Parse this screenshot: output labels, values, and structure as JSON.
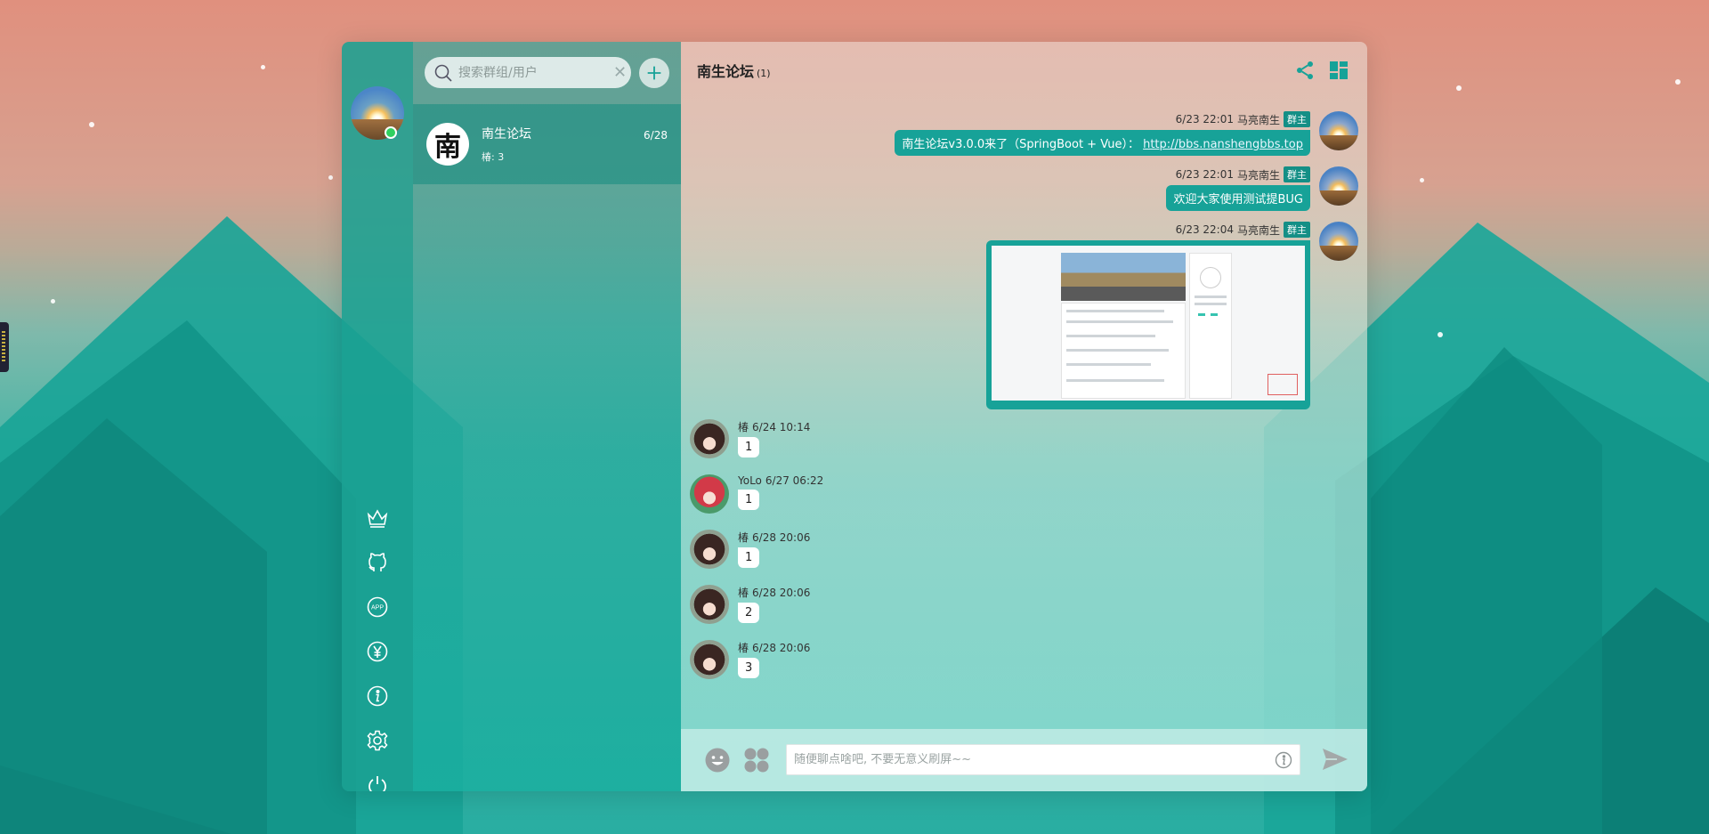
{
  "sidebar": {
    "user": {
      "online": true
    },
    "icons": [
      "crown-icon",
      "github-icon",
      "app-icon",
      "yen-icon",
      "info-icon",
      "settings-icon",
      "power-icon"
    ],
    "app_icon_text": "APP"
  },
  "search": {
    "placeholder": "搜索群组/用户"
  },
  "conversations": [
    {
      "name": "南生论坛",
      "last_message": "椿: 3",
      "date": "6/28",
      "logo_char": "南"
    }
  ],
  "chat": {
    "title": "南生论坛",
    "member_count": "(1)",
    "owner_badge": "群主",
    "messages": [
      {
        "side": "right",
        "time": "6/23 22:01",
        "user": "马亮南生",
        "text": "南生论坛v3.0.0来了（SpringBoot + Vue）：",
        "link": "http://bbs.nanshengbbs.top"
      },
      {
        "side": "right",
        "time": "6/23 22:01",
        "user": "马亮南生",
        "text": "欢迎大家使用测试提BUG"
      },
      {
        "side": "right",
        "time": "6/23 22:04",
        "user": "马亮南生",
        "image": true
      },
      {
        "side": "left",
        "user": "椿",
        "time": "6/24 10:14",
        "text": "1"
      },
      {
        "side": "left",
        "user": "YoLo",
        "time": "6/27 06:22",
        "text": "1"
      },
      {
        "side": "left",
        "user": "椿",
        "time": "6/28 20:06",
        "text": "1"
      },
      {
        "side": "left",
        "user": "椿",
        "time": "6/28 20:06",
        "text": "2"
      },
      {
        "side": "left",
        "user": "椿",
        "time": "6/28 20:06",
        "text": "3"
      }
    ]
  },
  "composer": {
    "placeholder": "随便聊点啥吧, 不要无意义刷屏~~"
  },
  "colors": {
    "accent": "#17a298",
    "badge": "#148f86",
    "online": "#30d060"
  }
}
